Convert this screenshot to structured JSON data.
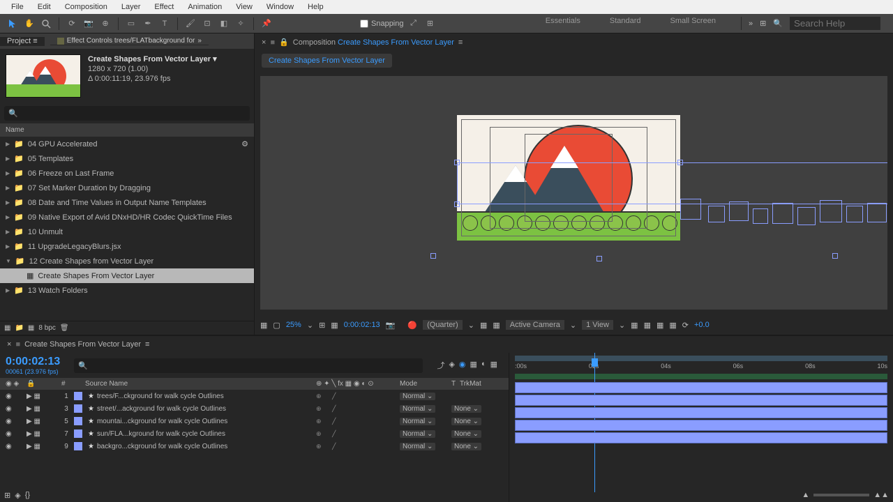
{
  "menu": [
    "File",
    "Edit",
    "Composition",
    "Layer",
    "Effect",
    "Animation",
    "View",
    "Window",
    "Help"
  ],
  "toolbar": {
    "snapping": "Snapping",
    "workspaces": [
      "Essentials",
      "Standard",
      "Small Screen"
    ],
    "search_ph": "Search Help"
  },
  "project": {
    "tab": "Project",
    "fx_tab": "Effect Controls trees/FLATbackground for",
    "comp_title": "Create Shapes From Vector Layer",
    "dims": "1280 x 720 (1.00)",
    "dur": "Δ 0:00:11:19, 23.976 fps",
    "name_col": "Name",
    "items": [
      "04 GPU Accelerated",
      "05 Templates",
      "06 Freeze on Last Frame",
      "07 Set Marker Duration by Dragging",
      "08 Date and Time Values in Output Name Templates",
      "09 Native Export of Avid DNxHD/HR Codec QuickTime Files",
      "10 Unmult",
      "11 UpgradeLegacyBlurs.jsx",
      "12 Create Shapes from Vector Layer"
    ],
    "selected": "Create Shapes From Vector Layer",
    "last": "13 Watch Folders",
    "bpc": "8 bpc"
  },
  "comp": {
    "breadcrumb_prefix": "Composition",
    "breadcrumb": "Create Shapes From Vector Layer",
    "nav": "Create Shapes From Vector Layer",
    "zoom": "25%",
    "time": "0:00:02:13",
    "quality": "(Quarter)",
    "camera": "Active Camera",
    "view": "1 View",
    "exposure": "+0.0"
  },
  "timeline": {
    "tab": "Create Shapes From Vector Layer",
    "time": "0:00:02:13",
    "fps": "00061 (23.976 fps)",
    "cols": {
      "num": "#",
      "source": "Source Name",
      "mode": "Mode",
      "t": "T",
      "tmat": "TrkMat"
    },
    "ruler": [
      ":00s",
      "02s",
      "04s",
      "06s",
      "08s",
      "10s"
    ],
    "layers": [
      {
        "n": "1",
        "name": "trees/F...ckground for walk cycle Outlines",
        "mode": "Normal",
        "tmat": ""
      },
      {
        "n": "3",
        "name": "street/...ackground for walk cycle Outlines",
        "mode": "Normal",
        "tmat": "None"
      },
      {
        "n": "5",
        "name": "mountai...ckground for walk cycle Outlines",
        "mode": "Normal",
        "tmat": "None"
      },
      {
        "n": "7",
        "name": "sun/FLA...kground for walk cycle Outlines",
        "mode": "Normal",
        "tmat": "None"
      },
      {
        "n": "9",
        "name": "backgro...ckground for walk cycle Outlines",
        "mode": "Normal",
        "tmat": "None"
      }
    ]
  }
}
